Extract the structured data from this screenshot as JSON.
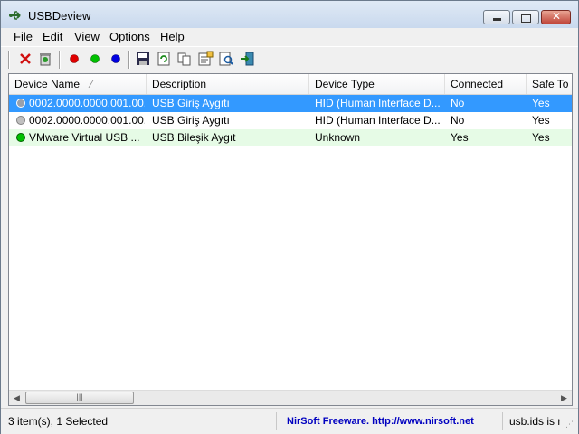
{
  "window": {
    "title": "USBDeview"
  },
  "menu": [
    "File",
    "Edit",
    "View",
    "Options",
    "Help"
  ],
  "toolbar": {
    "buttons": [
      {
        "name": "disconnect-device-icon"
      },
      {
        "name": "uninstall-device-icon"
      },
      {
        "name": "red-dot-icon",
        "color": "#e00000"
      },
      {
        "name": "green-dot-icon",
        "color": "#00c000"
      },
      {
        "name": "blue-dot-icon",
        "color": "#0000e0"
      },
      {
        "name": "save-icon"
      },
      {
        "name": "refresh-icon"
      },
      {
        "name": "copy-icon"
      },
      {
        "name": "properties-icon"
      },
      {
        "name": "find-icon"
      },
      {
        "name": "exit-icon"
      }
    ]
  },
  "table": {
    "columns": [
      "Device Name",
      "Description",
      "Device Type",
      "Connected",
      "Safe To U"
    ],
    "sort_indicator": "⁄",
    "rows": [
      {
        "device_name": "0002.0000.0000.001.00...",
        "description": "USB Giriş Aygıtı",
        "device_type": "HID (Human Interface D...",
        "connected": "No",
        "safe": "Yes",
        "dot": "#9aa0aa",
        "state": "selected"
      },
      {
        "device_name": "0002.0000.0000.001.00...",
        "description": "USB Giriş Aygıtı",
        "device_type": "HID (Human Interface D...",
        "connected": "No",
        "safe": "Yes",
        "dot": "#c0c0c0",
        "state": "normal"
      },
      {
        "device_name": "VMware Virtual USB ...",
        "description": "USB Bileşik Aygıt",
        "device_type": "Unknown",
        "connected": "Yes",
        "safe": "Yes",
        "dot": "#00c000",
        "state": "connected"
      }
    ]
  },
  "status": {
    "items": "3 item(s), 1 Selected",
    "link": "NirSoft Freeware.  http://www.nirsoft.net",
    "extra": "usb.ids is n"
  },
  "colors": {
    "selection": "#3399ff",
    "connected_row": "#e6fbe6",
    "link": "#0000c0"
  }
}
